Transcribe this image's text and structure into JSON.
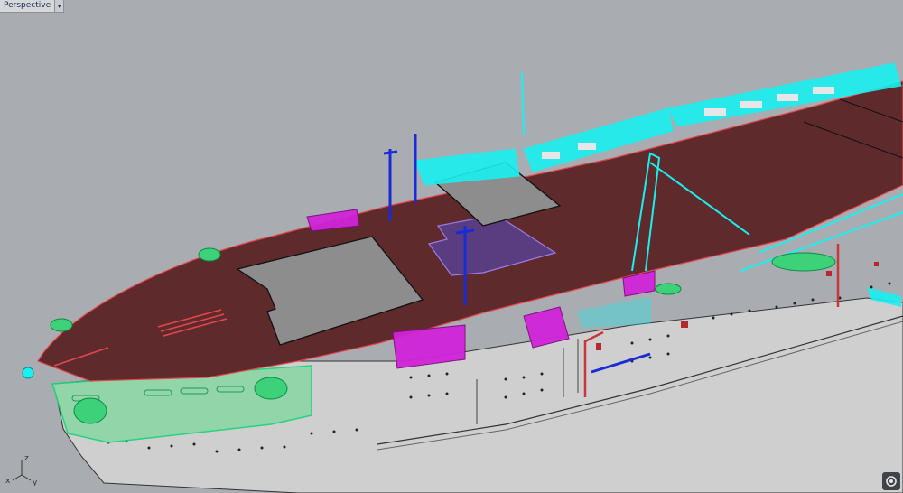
{
  "viewport": {
    "title": "Perspective",
    "dropdown_icon": "chevron-down-icon",
    "background_color": "#a9acb1"
  },
  "axis_widget": {
    "z_label": "z",
    "x_label": "x",
    "y_label": "y"
  },
  "corner_button": {
    "icon": "navigation-wheel-icon"
  },
  "colors": {
    "flight_deck": "#5e2a2c",
    "hull": "#cfcfcf",
    "selection_cyan": "#19f0f0",
    "selection_magenta": "#d024d8",
    "selection_green": "#3dd27a",
    "mast_blue": "#1a2ad6",
    "elevator_gray": "#8d8d8d",
    "accent_red": "#e2474e"
  }
}
